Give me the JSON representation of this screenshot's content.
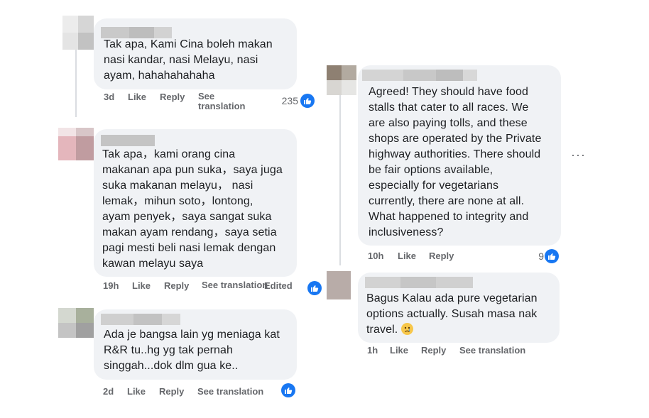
{
  "comments": [
    {
      "id": "c1",
      "text": "Tak apa, Kami Cina boleh makan\nnasi kandar, nasi Melayu, nasi\nayam, hahahahahaha",
      "time": "3d",
      "like": "Like",
      "reply": "Reply",
      "see_translation": "See\ntranslation",
      "reactions": "235"
    },
    {
      "id": "c2",
      "text": "Tak apa，kami orang cina\nmakanan apa pun suka，saya juga\nsuka makanan melayu，  nasi\nlemak，mihun soto，lontong,\nayam penyek，saya sangat suka\nmakan ayam rendang，saya setia\npagi mesti beli nasi lemak dengan\nkawan melayu saya",
      "time": "19h",
      "like": "Like",
      "reply": "Reply",
      "see_translation": "See\ntranslation",
      "edited": "Edited"
    },
    {
      "id": "c3",
      "text": "Ada je bangsa lain yg meniaga kat\nR&R tu..hg yg tak pernah\nsinggah...dok dlm gua ke..",
      "time": "2d",
      "like": "Like",
      "reply": "Reply",
      "see_translation": "See translation"
    },
    {
      "id": "c4",
      "text": "Agreed! They should have food\nstalls that cater to all races. We\nare also paying tolls, and these\nshops are operated by the Private\nhighway authorities. There should\nbe fair options available,\nespecially for vegetarians\ncurrently, there are none at all.\nWhat happened to integrity and\ninclusiveness?",
      "time": "10h",
      "like": "Like",
      "reply": "Reply",
      "reactions": "9",
      "more": "···"
    },
    {
      "id": "c5",
      "text": "Bagus Kalau ada pure vegetarian\noptions actually. Susah masa nak\ntravel.",
      "time": "1h",
      "like": "Like",
      "reply": "Reply",
      "see_translation": "See translation",
      "emoji": "crying-face"
    }
  ],
  "colors": {
    "bubble": "#f0f2f5",
    "meta": "#65676b",
    "like_blue": "#1877f2",
    "thread_line": "#dadde1"
  }
}
